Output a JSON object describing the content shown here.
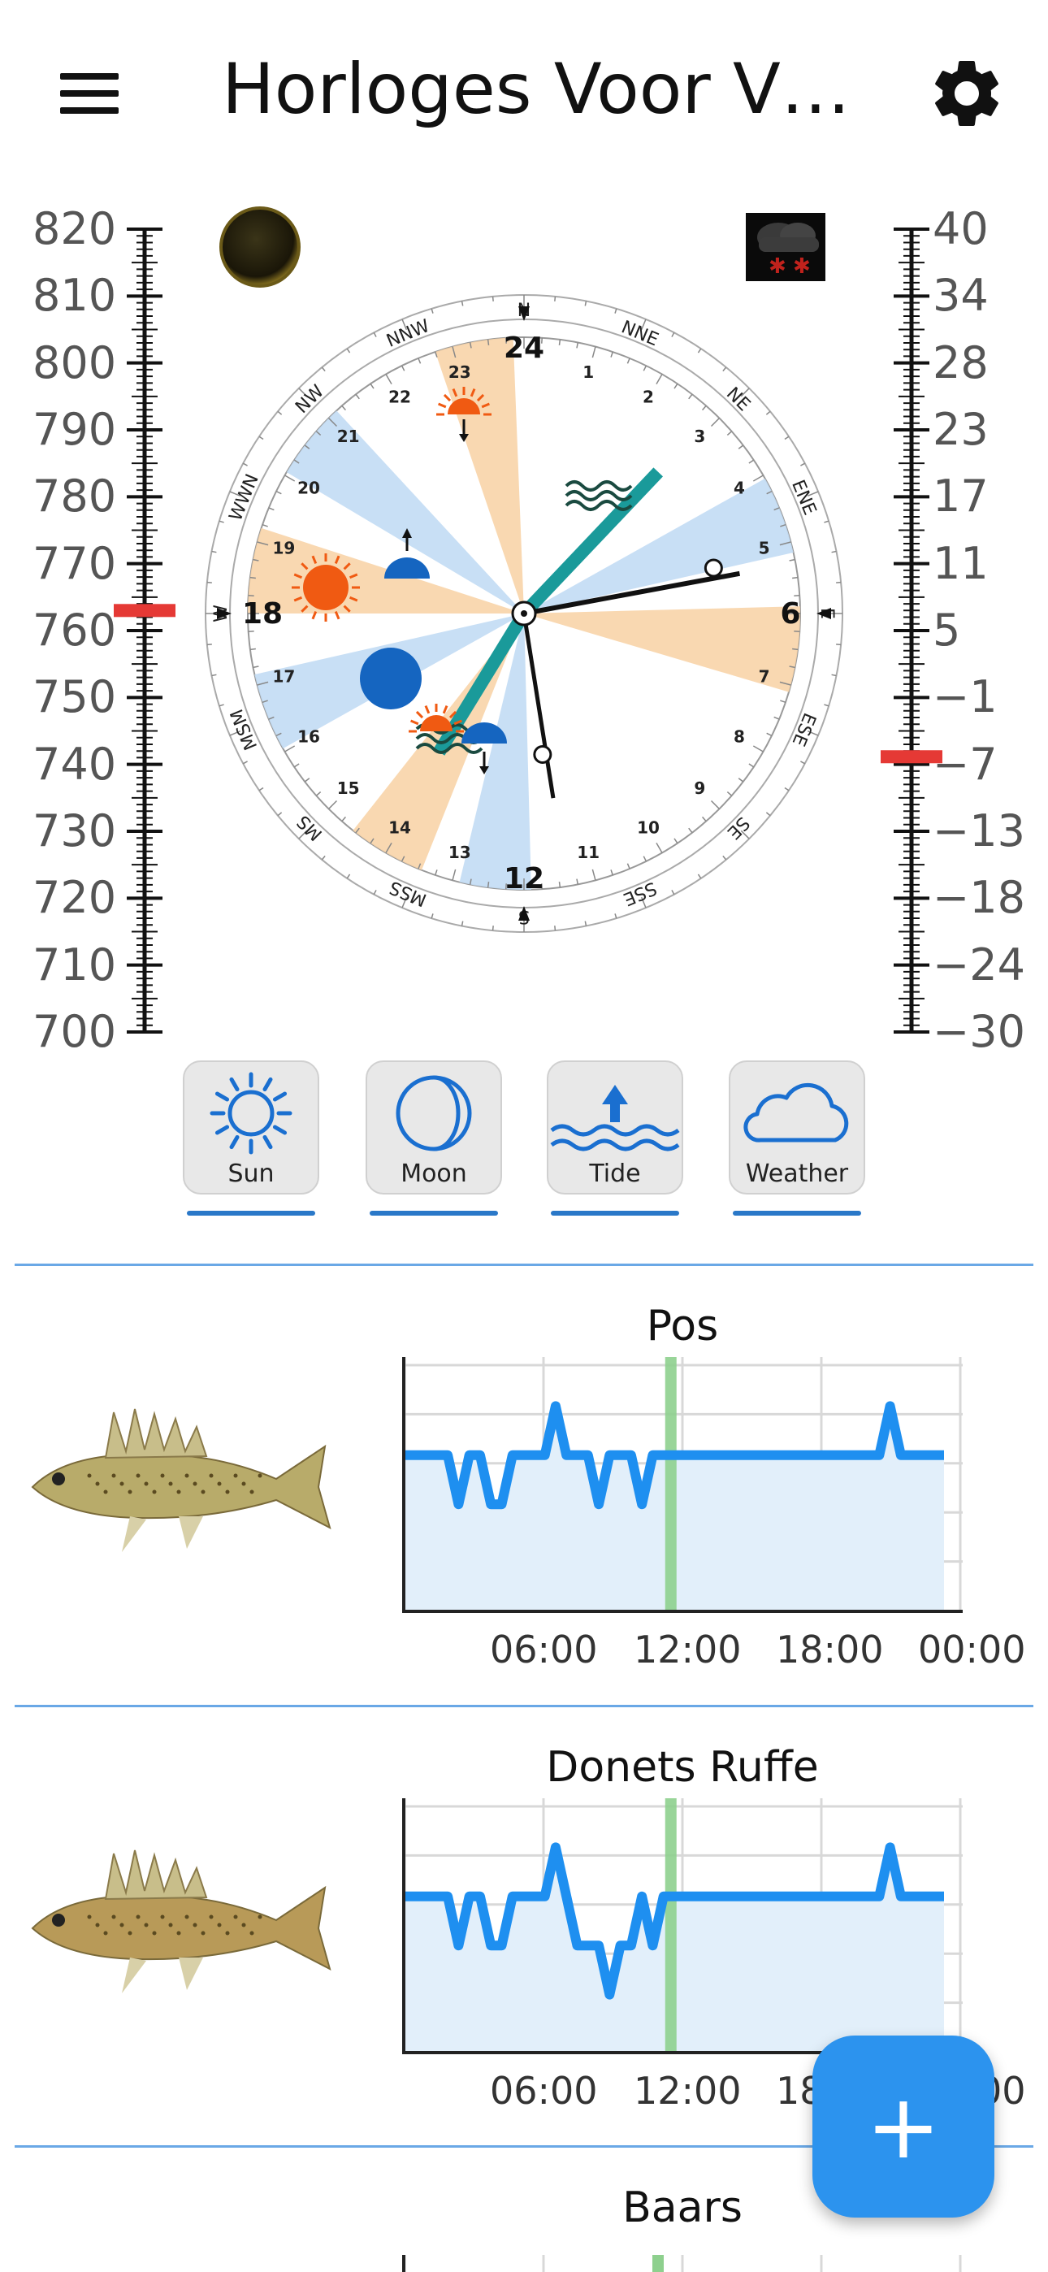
{
  "app_bar": {
    "title": "Horloges Voor V…",
    "menu_icon": "menu-icon",
    "settings_icon": "gear-icon"
  },
  "pressure_scale": {
    "labels": [
      "820",
      "810",
      "800",
      "790",
      "780",
      "770",
      "760",
      "750",
      "740",
      "730",
      "720",
      "710",
      "700"
    ],
    "current_value": 763,
    "marker_color": "#e53935"
  },
  "temperature_scale": {
    "labels": [
      "40",
      "34",
      "28",
      "23",
      "17",
      "11",
      "5",
      "−1",
      "−7",
      "−13",
      "−18",
      "−24",
      "−30"
    ],
    "current_value": -6,
    "marker_color": "#e53935"
  },
  "moon_icon": "moon-phase-icon",
  "weather_icon": "weather-snow-icon",
  "dial": {
    "hour_labels": [
      "24",
      "6",
      "12",
      "18"
    ],
    "minor_hours": [
      "1",
      "2",
      "3",
      "4",
      "5",
      "7",
      "8",
      "9",
      "10",
      "11",
      "13",
      "14",
      "15",
      "16",
      "17",
      "19",
      "20",
      "21",
      "22",
      "23"
    ],
    "compass": [
      "N",
      "NNE",
      "NE",
      "ENE",
      "E",
      "ESE",
      "SE",
      "SSE",
      "S",
      "SSW",
      "SW",
      "WSW",
      "W",
      "WNW",
      "NW",
      "NNW"
    ],
    "compass_display": {
      "N": "N",
      "NNE": "NNE",
      "NE": "NE",
      "ENE": "ENE",
      "E": "E",
      "ESE": "ESE",
      "SE": "SE",
      "SSE": "SSE",
      "S": "S",
      "SSW": "MSS",
      "SW": "MS",
      "WSW": "MSM",
      "W": "W",
      "WNW": "WWN",
      "NW": "NW",
      "NNW": "NNW"
    },
    "sun_color": "#f05a12",
    "moon_color": "#1565c0",
    "tide_color": "#1a9a9a"
  },
  "mode_buttons": [
    {
      "label": "Sun",
      "icon": "sun-icon"
    },
    {
      "label": "Moon",
      "icon": "moon-icon"
    },
    {
      "label": "Tide",
      "icon": "tide-icon"
    },
    {
      "label": "Weather",
      "icon": "cloud-icon"
    }
  ],
  "fish": [
    {
      "name": "Pos",
      "image": "ruffe-fish-image",
      "x_ticks": [
        "06:00",
        "12:00",
        "18:00",
        "00:00"
      ],
      "activity": [
        3,
        3,
        3,
        3,
        3,
        2,
        3,
        3,
        2,
        2,
        3,
        3,
        3,
        3,
        4,
        3,
        3,
        3,
        2,
        3,
        3,
        3,
        2,
        3,
        3,
        3,
        3,
        3,
        3,
        3,
        3,
        3,
        3,
        3,
        3,
        3,
        3,
        3,
        3,
        3,
        3,
        3,
        3,
        3,
        3,
        4,
        3,
        3,
        3,
        3,
        3
      ]
    },
    {
      "name": "Donets Ruffe",
      "image": "donets-ruffe-fish-image",
      "x_ticks": [
        "06:00",
        "12:00",
        "18:00",
        "00:00"
      ],
      "activity": [
        3,
        3,
        3,
        3,
        3,
        2,
        3,
        3,
        2,
        2,
        3,
        3,
        3,
        3,
        4,
        3,
        2,
        2,
        2,
        1,
        2,
        2,
        3,
        2,
        3,
        3,
        3,
        3,
        3,
        3,
        3,
        3,
        3,
        3,
        3,
        3,
        3,
        3,
        3,
        3,
        3,
        3,
        3,
        3,
        3,
        4,
        3,
        3,
        3,
        3,
        3
      ]
    },
    {
      "name": "Baars",
      "image": "perch-fish-image"
    }
  ],
  "fab": {
    "label": "+",
    "icon": "plus-icon"
  },
  "colors": {
    "accent": "#2c93ee",
    "line": "#1e8ff0",
    "now_marker": "#8ed08e"
  }
}
